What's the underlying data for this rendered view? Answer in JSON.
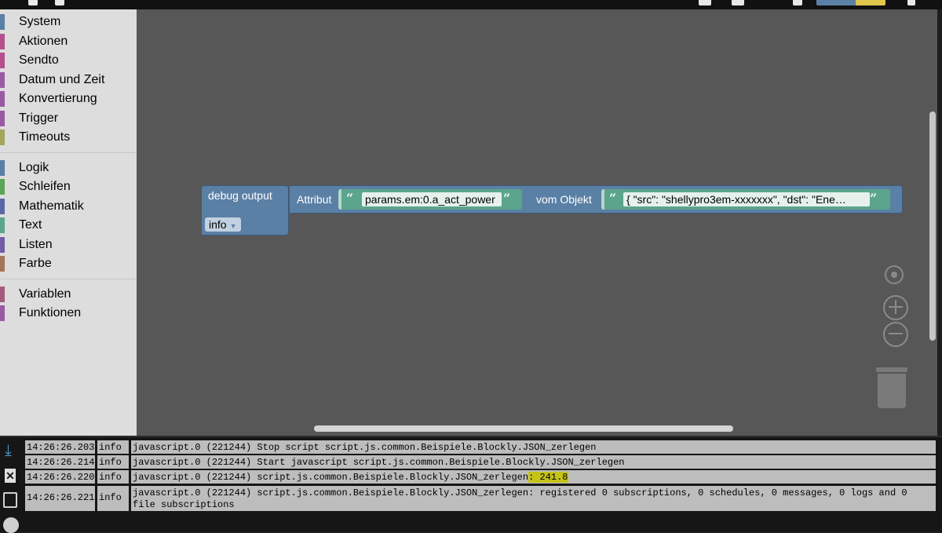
{
  "toolbox": {
    "categories": [
      {
        "label": "System",
        "color": "#5b80a5"
      },
      {
        "label": "Aktionen",
        "color": "#b5508f"
      },
      {
        "label": "Sendto",
        "color": "#b5508f"
      },
      {
        "label": "Datum und Zeit",
        "color": "#9a5ba5"
      },
      {
        "label": "Konvertierung",
        "color": "#9a5ba5"
      },
      {
        "label": "Trigger",
        "color": "#9a5ba5"
      },
      {
        "label": "Timeouts",
        "color": "#a5a55b"
      }
    ],
    "categories2": [
      {
        "label": "Logik",
        "color": "#5b80a5"
      },
      {
        "label": "Schleifen",
        "color": "#5ba55b"
      },
      {
        "label": "Mathematik",
        "color": "#5b67a5"
      },
      {
        "label": "Text",
        "color": "#5ba58c"
      },
      {
        "label": "Listen",
        "color": "#745ba5"
      },
      {
        "label": "Farbe",
        "color": "#a5745b"
      }
    ],
    "categories3": [
      {
        "label": "Variablen",
        "color": "#a55b80"
      },
      {
        "label": "Funktionen",
        "color": "#995ba5"
      }
    ]
  },
  "blocks": {
    "debug_label": "debug output",
    "severity_value": "info",
    "attr_label": "Attribut",
    "attr_value": "params.em:0.a_act_power",
    "object_label": "vom Objekt",
    "object_value": "{   \"src\": \"shellypro3em-xxxxxxx\",   \"dst\": \"Ene…"
  },
  "log": {
    "rows": [
      {
        "time": "14:26:26.203",
        "severity": "info",
        "message": "javascript.0 (221244) Stop script script.js.common.Beispiele.Blockly.JSON_zerlegen",
        "highlight": ""
      },
      {
        "time": "14:26:26.214",
        "severity": "info",
        "message": "javascript.0 (221244) Start javascript script.js.common.Beispiele.Blockly.JSON_zerlegen",
        "highlight": ""
      },
      {
        "time": "14:26:26.220",
        "severity": "info",
        "message": "javascript.0 (221244) script.js.common.Beispiele.Blockly.JSON_zerlegen",
        "highlight": ": 241.8"
      },
      {
        "time": "14:26:26.221",
        "severity": "info",
        "message": "javascript.0 (221244) script.js.common.Beispiele.Blockly.JSON_zerlegen: registered 0 subscriptions, 0 schedules, 0 messages, 0 logs and 0 file subscriptions",
        "highlight": ""
      }
    ]
  },
  "icons": {
    "log_download": "download-icon",
    "log_clear": "clear-icon",
    "log_copy": "copy-icon",
    "log_menu": "menu-icon",
    "recenter": "crosshair-icon",
    "zoom_in": "zoom-in-icon",
    "zoom_out": "zoom-out-icon",
    "trash": "trash-icon"
  }
}
